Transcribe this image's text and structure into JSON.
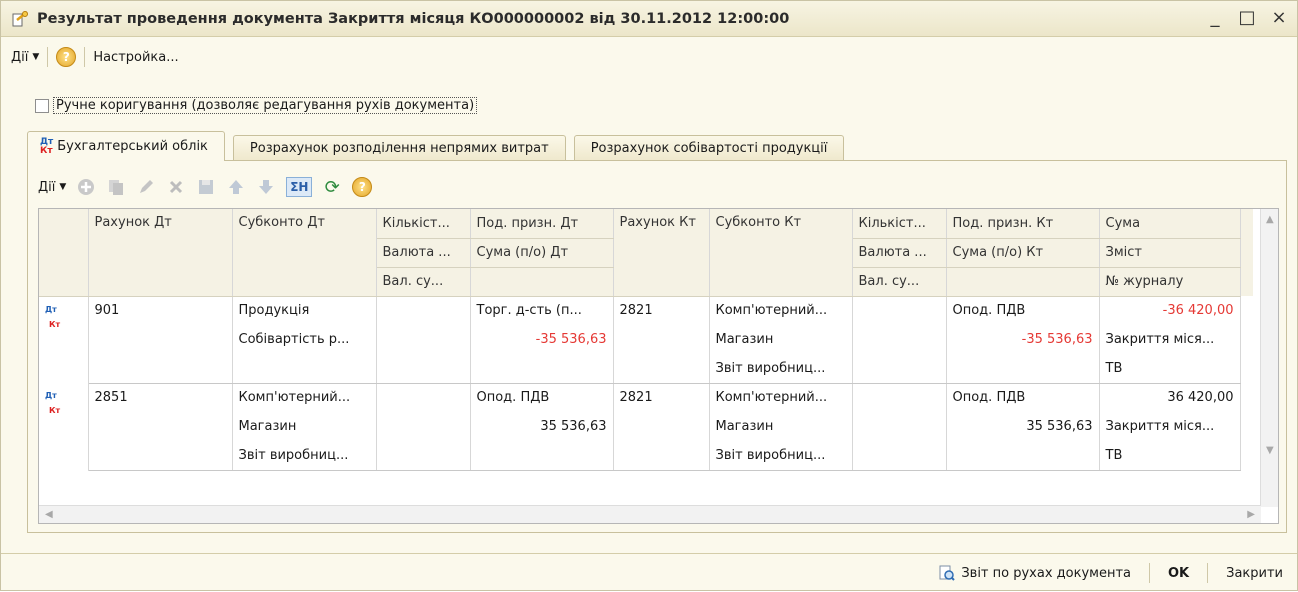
{
  "window": {
    "title": "Результат проведення документа Закриття місяця КО000000002 від 30.11.2012 12:00:00",
    "controls": {
      "minimize": "_",
      "maximize": "□",
      "close": "×"
    }
  },
  "toolbar": {
    "actions_label": "Дії",
    "help": "?",
    "settings_label": "Настройка..."
  },
  "manual_adjust_label": "Ручне коригування (дозволяє редагування рухів документа)",
  "tabs": [
    {
      "label": "Бухгалтерський облік",
      "icon_top": "Дт",
      "icon_bottom": "Кт"
    },
    {
      "label": "Розрахунок розподілення непрямих витрат"
    },
    {
      "label": "Розрахунок собівартості продукції"
    }
  ],
  "inner_toolbar": {
    "actions_label": "Дії",
    "sum_label": "ΣН",
    "help": "?"
  },
  "table": {
    "headers": [
      [
        "Рахунок Дт",
        "Субконто Дт",
        "Кількіст...",
        "Под. призн. Дт",
        "Рахунок Кт",
        "Субконто Кт",
        "Кількіст...",
        "Под. призн. Кт",
        "Сума"
      ],
      [
        "",
        "",
        "Валюта ...",
        "Сума (п/о) Дт",
        "",
        "",
        "Валюта ...",
        "Сума (п/о) Кт",
        "Зміст"
      ],
      [
        "",
        "",
        "Вал. су...",
        "",
        "",
        "",
        "Вал. су...",
        "",
        "№ журналу"
      ]
    ],
    "rows": [
      [
        [
          "901",
          "Продукція",
          "",
          "Торг. д-сть (п...",
          "2821",
          "Комп'ютерний...",
          "",
          "Опод. ПДВ",
          "-36 420,00"
        ],
        [
          "",
          "Собівартість р...",
          "",
          "-35 536,63",
          "",
          "Магазин",
          "",
          "-35 536,63",
          "Закриття міся..."
        ],
        [
          "",
          "",
          "",
          "",
          "",
          "Звіт виробниц...",
          "",
          "",
          "ТВ"
        ]
      ],
      [
        [
          "2851",
          "Комп'ютерний...",
          "",
          "Опод. ПДВ",
          "2821",
          "Комп'ютерний...",
          "",
          "Опод. ПДВ",
          "36 420,00"
        ],
        [
          "",
          "Магазин",
          "",
          "35 536,63",
          "",
          "Магазин",
          "",
          "35 536,63",
          "Закриття міся..."
        ],
        [
          "",
          "Звіт виробниц...",
          "",
          "",
          "",
          "Звіт виробниц...",
          "",
          "",
          "ТВ"
        ]
      ]
    ]
  },
  "statusbar": {
    "report_label": "Звіт по рухах документа",
    "ok_label": "OK",
    "close_label": "Закрити"
  }
}
